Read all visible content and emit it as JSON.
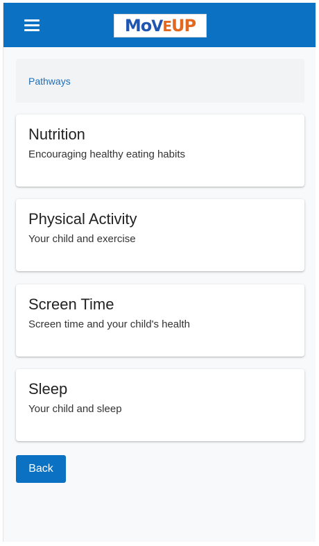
{
  "header": {
    "logo": {
      "part1": "MoVe",
      "part2": "UP",
      "colors": {
        "blue": "#1f56b0",
        "orange": "#e3681f"
      }
    },
    "menu_icon": "hamburger-menu-icon",
    "accent_color": "#0b72c3"
  },
  "breadcrumb": {
    "label": "Pathways"
  },
  "cards": [
    {
      "title": "Nutrition",
      "description": "Encouraging healthy eating habits"
    },
    {
      "title": "Physical Activity",
      "description": "Your child and exercise"
    },
    {
      "title": "Screen Time",
      "description": "Screen time and your child's health"
    },
    {
      "title": "Sleep",
      "description": "Your child and sleep"
    }
  ],
  "back_button": {
    "label": "Back"
  }
}
